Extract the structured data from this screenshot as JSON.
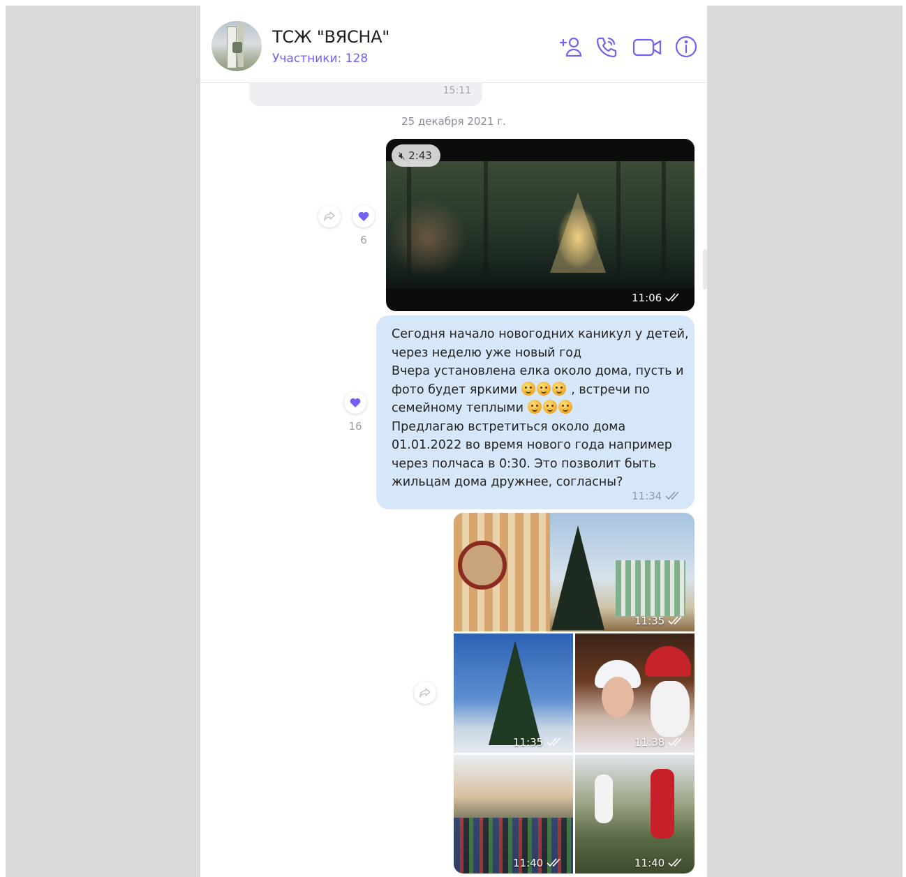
{
  "chat": {
    "title": "ТСЖ \"ВЯСНА\"",
    "participants": "Участники: 128",
    "header_icons": [
      "add-participant-icon",
      "phone-icon",
      "video-call-icon",
      "info-icon"
    ]
  },
  "prev_message": {
    "time": "15:11"
  },
  "date_separator": "25 декабря 2021 г.",
  "video_message": {
    "duration": "2:43",
    "muted": true,
    "time": "11:06",
    "likes": "6"
  },
  "text_message": {
    "lines": [
      "Сегодня начало новогодних каникул у детей,",
      "через неделю уже новый год",
      "Вчера установлена елка около дома, пусть и",
      "фото будет яркими",
      ", встречи по",
      "семейному теплыми",
      "Предлагаю встретиться около дома",
      "01.01.2022 во время нового года например",
      "через полчаса в 0:30. Это позволит быть",
      "жильцам дома дружнее, согласны?"
    ],
    "time": "11:34",
    "likes": "16"
  },
  "gallery": {
    "photos": [
      {
        "time": "11:35"
      },
      {
        "time": "11:35"
      },
      {
        "time": "11:38"
      },
      {
        "time": "11:40"
      },
      {
        "time": "11:40"
      }
    ]
  },
  "colors": {
    "accent": "#7360f2",
    "bubble": "#d7e7fa",
    "side_bg": "#d9d9d9"
  }
}
